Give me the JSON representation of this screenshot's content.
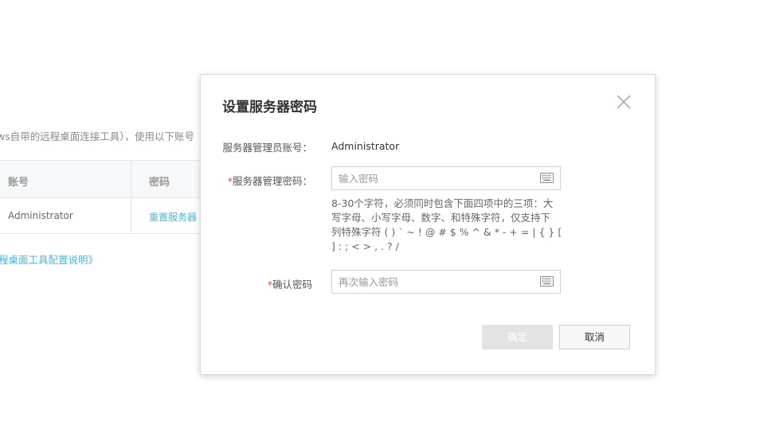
{
  "background": {
    "description": "ws自带的远程桌面连接工具），使用以下账号",
    "table": {
      "headers": [
        "账号",
        "密码"
      ],
      "row": {
        "account": "Administrator",
        "action_link": "重置服务器"
      }
    },
    "bottom_link": "程桌面工具配置说明》"
  },
  "modal": {
    "title": "设置服务器密码",
    "account_label": "服务器管理员账号：",
    "account_value": "Administrator",
    "password_label": "服务器管理密码：",
    "password_placeholder": "输入密码",
    "required_mark": "*",
    "hint_lines": [
      "8-30个字符，必须同时包含下面四项中的三项：大",
      "写字母、小写字母、数字、和特殊字符，仅支持下",
      "列特殊字符 ( ) ` ~ ! @ # $ % ^ & * - + = | { } [",
      "] : ; < > , . ? /"
    ],
    "confirm_label": "确认密码",
    "confirm_placeholder": "再次输入密码",
    "ok_button": "确定",
    "cancel_button": "取消"
  },
  "colors": {
    "link": "#45b9e0",
    "required": "#e84c3d",
    "disabled_button": "#e3e3e3"
  },
  "icons": {
    "close": "close-icon",
    "keyboard": "keyboard-icon"
  }
}
